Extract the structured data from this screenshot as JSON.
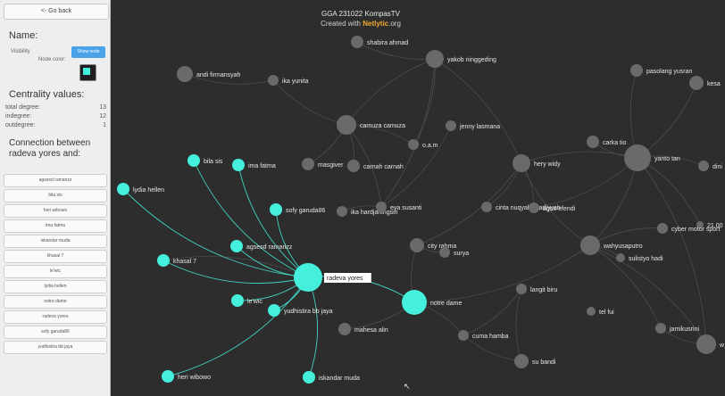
{
  "sidebar": {
    "back_label": "<- Go back",
    "name_heading": "Name:",
    "visibility_label": "Visibility",
    "node_color_label": "Node color:",
    "show_button_label": "Show node",
    "centrality_heading": "Centrality values:",
    "stats": [
      {
        "label": "total degree:",
        "value": "13"
      },
      {
        "label": "indegree:",
        "value": "12"
      },
      {
        "label": "outdegree:",
        "value": "1"
      }
    ],
    "connection_heading": "Connection between radeva yores and:",
    "connections": [
      "agsesd ramarizz",
      "bila sis",
      "heri wibowo",
      "ima fatma",
      "iskandar muda",
      "khasal 7",
      "le'wic",
      "lydia hellen",
      "notre dame",
      "radeva yores",
      "sofy garuda86",
      "yudhistira bb jaya"
    ]
  },
  "graph": {
    "title": "GGA 231022 KompasTV",
    "subtitle_prefix": "Created with ",
    "subtitle_brand": "Netlytic",
    "subtitle_suffix": ".org",
    "highlight_color": "#44f0dc",
    "node_color": "#6a6a6a",
    "edge_color": "#4c4c4c",
    "focus_node": "radeva yores",
    "nodes": [
      {
        "label": "shabira ahmad",
        "hl": false
      },
      {
        "label": "yakob ninggeding",
        "hl": false
      },
      {
        "label": "andi firmansyah",
        "hl": false
      },
      {
        "label": "ika yunita",
        "hl": false
      },
      {
        "label": "pasolang yusran",
        "hl": false
      },
      {
        "label": "kesa",
        "hl": false
      },
      {
        "label": "camuza camuza",
        "hl": false
      },
      {
        "label": "jenny lasmana",
        "hl": false
      },
      {
        "label": "o.a.m",
        "hl": false
      },
      {
        "label": "carka tio",
        "hl": false
      },
      {
        "label": "yanto tan",
        "hl": false
      },
      {
        "label": "dini",
        "hl": false
      },
      {
        "label": "bila sis",
        "hl": true
      },
      {
        "label": "ima fatma",
        "hl": true
      },
      {
        "label": "masgiver",
        "hl": false
      },
      {
        "label": "carnah carnah",
        "hl": false
      },
      {
        "label": "hery widy",
        "hl": false
      },
      {
        "label": "lydia hellen",
        "hl": true
      },
      {
        "label": "sofy garuda86",
        "hl": true
      },
      {
        "label": "ika hardjaningsih",
        "hl": false
      },
      {
        "label": "eva susanti",
        "hl": false
      },
      {
        "label": "cinta nuqyah syadiyyah",
        "hl": false
      },
      {
        "label": "agus efendi",
        "hl": false
      },
      {
        "label": "21.00",
        "hl": false
      },
      {
        "label": "cyber motor sport",
        "hl": false
      },
      {
        "label": "agsesd ramarizz",
        "hl": true
      },
      {
        "label": "city rahma",
        "hl": false
      },
      {
        "label": "surya",
        "hl": false
      },
      {
        "label": "wahyusaputro",
        "hl": false
      },
      {
        "label": "sulistyo hadi",
        "hl": false
      },
      {
        "label": "khasal 7",
        "hl": true
      },
      {
        "label": "radeva yores",
        "hl": true
      },
      {
        "label": "langit biru",
        "hl": false
      },
      {
        "label": "le'wic",
        "hl": true
      },
      {
        "label": "notre dame",
        "hl": true
      },
      {
        "label": "yudhistira bb jaya",
        "hl": true
      },
      {
        "label": "tel fui",
        "hl": false
      },
      {
        "label": "mahesa alin",
        "hl": false
      },
      {
        "label": "cuma hamba",
        "hl": false
      },
      {
        "label": "jamikusrini",
        "hl": false
      },
      {
        "label": "w",
        "hl": false
      },
      {
        "label": "su bandi",
        "hl": false
      },
      {
        "label": "heri wibowo",
        "hl": true
      },
      {
        "label": "iskandar muda",
        "hl": true
      }
    ]
  }
}
